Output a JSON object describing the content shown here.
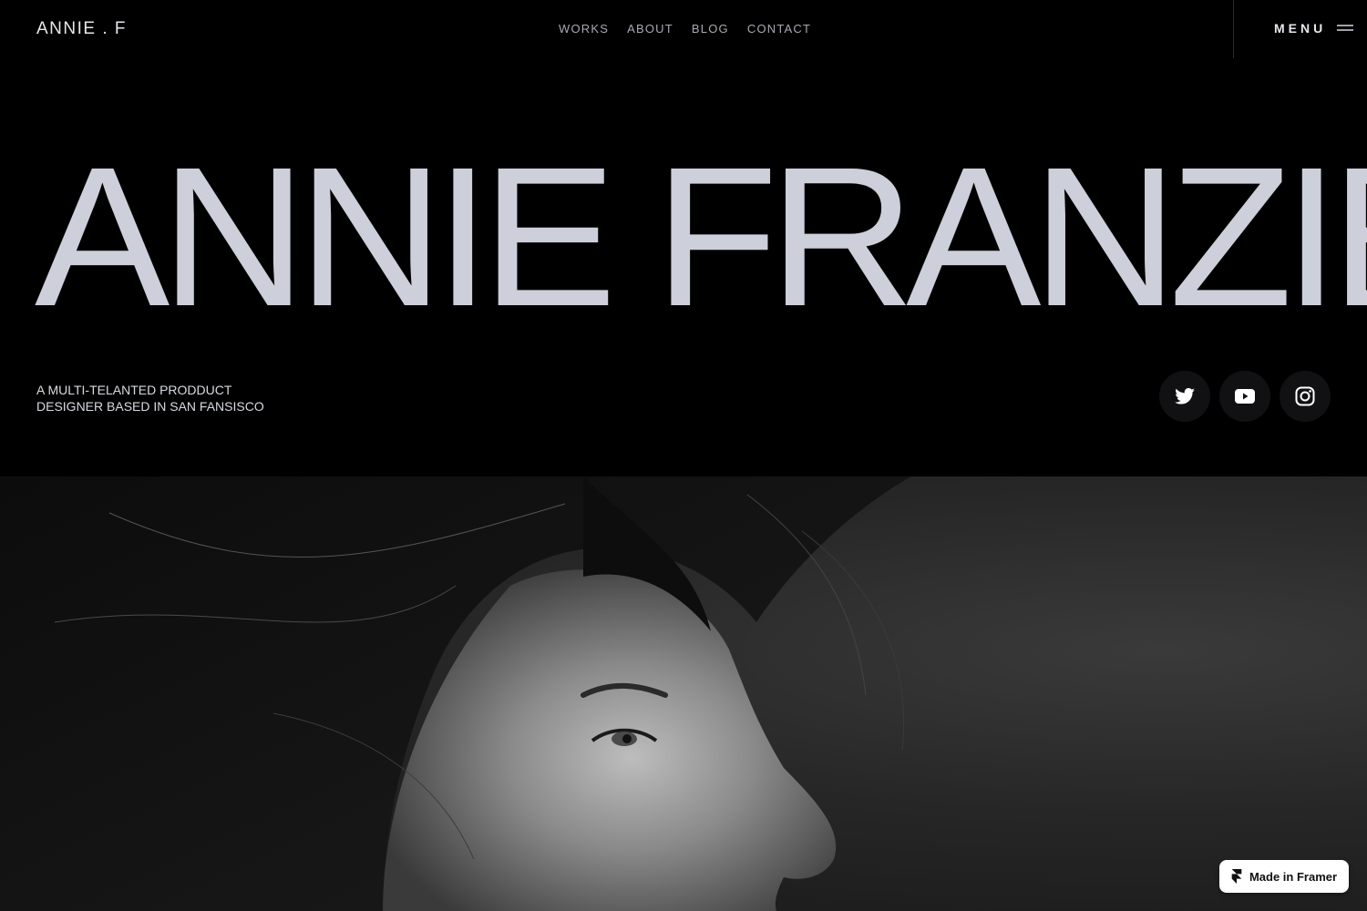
{
  "header": {
    "logo": "ANNIE . F",
    "nav": [
      "WORKS",
      "ABOUT",
      "BLOG",
      "CONTACT"
    ],
    "menu_label": "MENU"
  },
  "hero": {
    "name": "ANNIE FRANZIE.",
    "tagline_line1": "A MULTI-TELANTED PRODDUCT",
    "tagline_line2": "DESIGNER BASED IN SAN FANSISCO"
  },
  "socials": [
    {
      "icon": "twitter-icon"
    },
    {
      "icon": "youtube-icon"
    },
    {
      "icon": "instagram-icon"
    }
  ],
  "badge": {
    "label": "Made in Framer"
  },
  "colors": {
    "background": "#000000",
    "hero_text": "#cdd0da",
    "nav_text": "#a7a9b1"
  }
}
